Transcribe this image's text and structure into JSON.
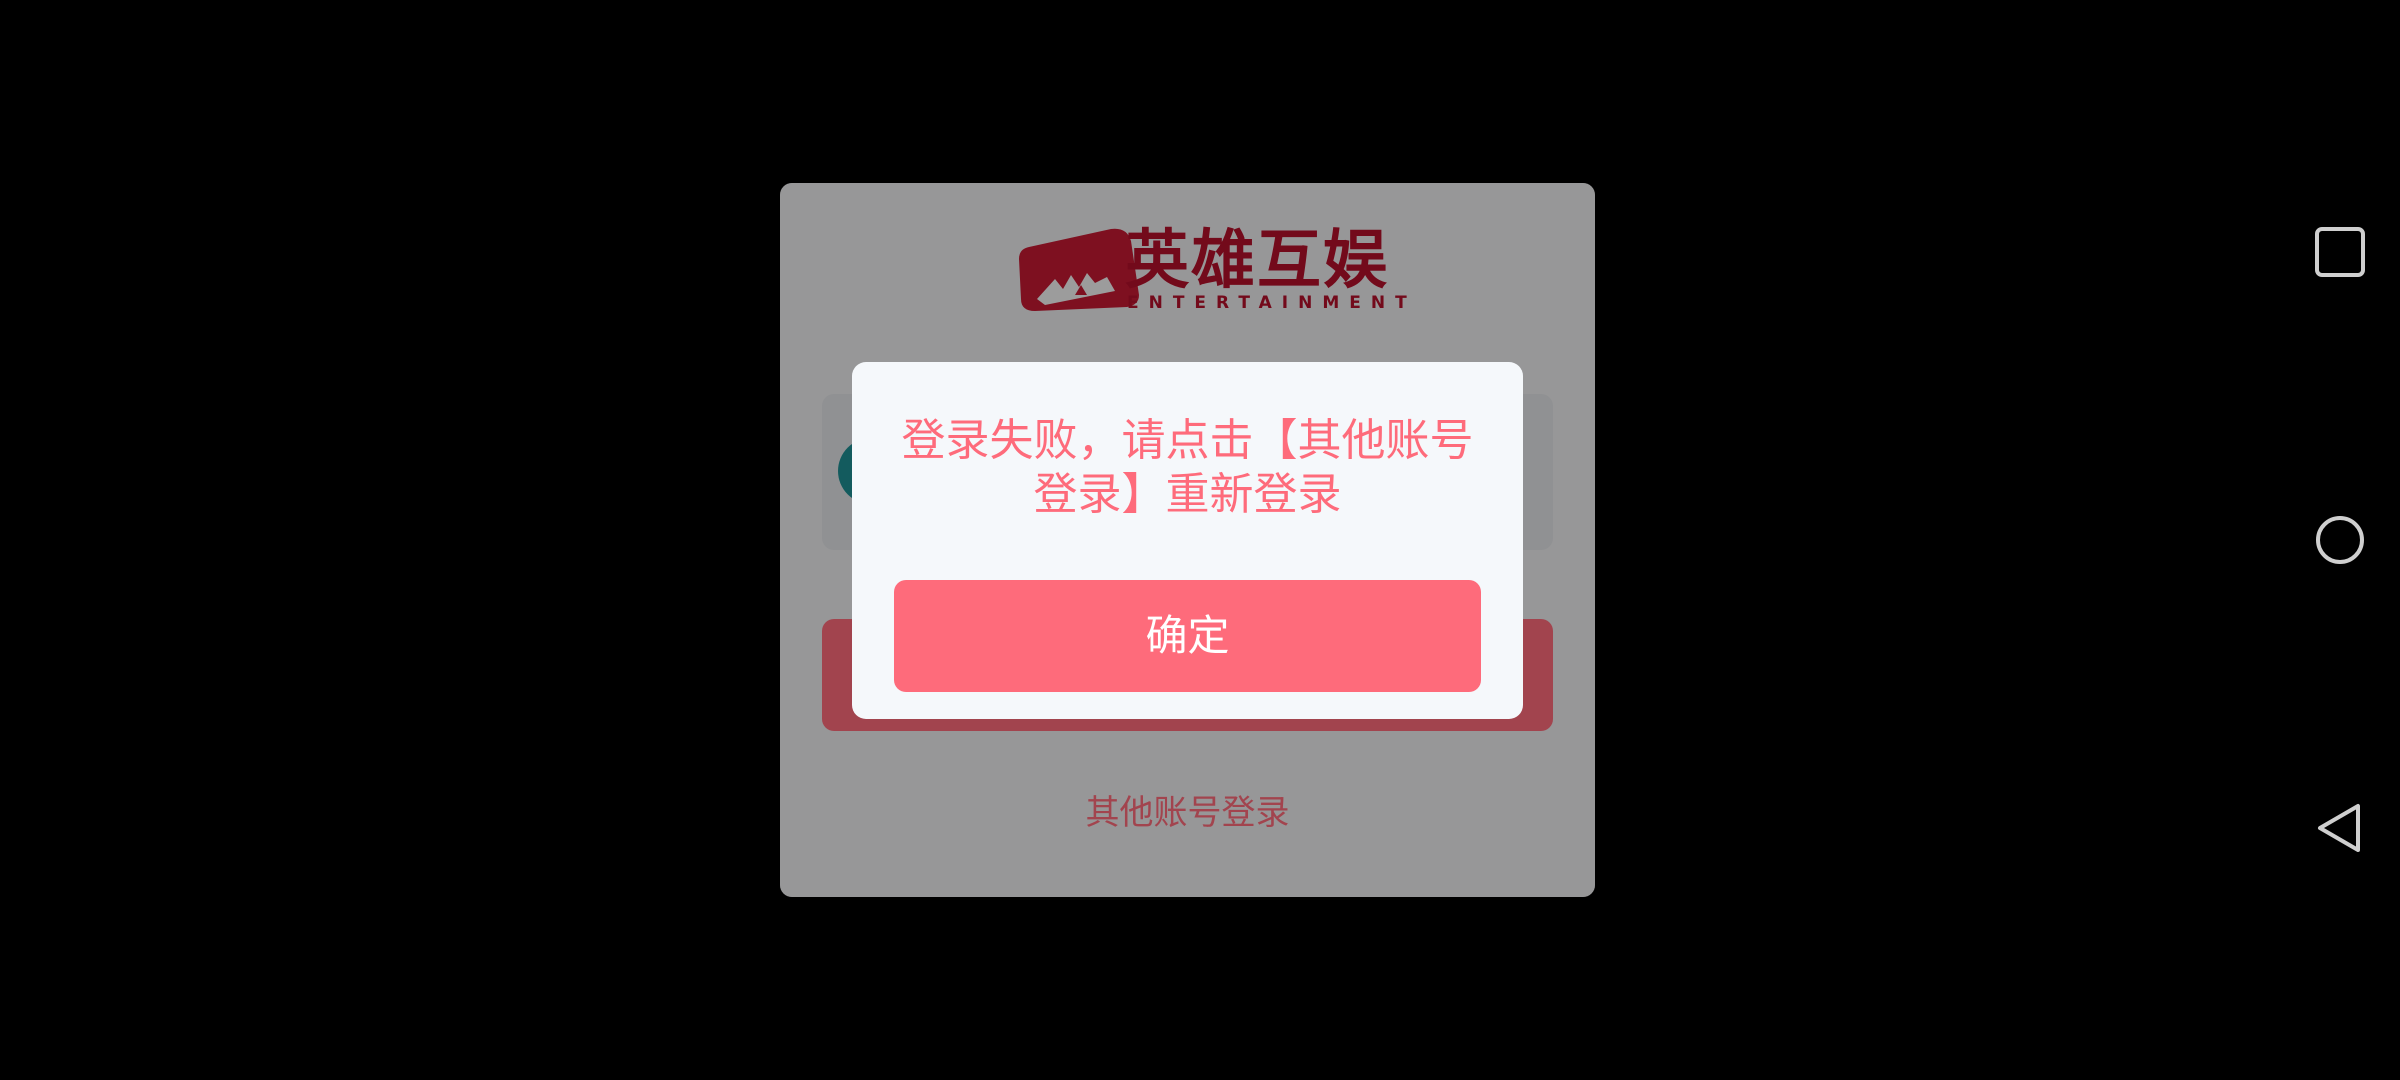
{
  "login_card": {
    "logo_text": "英雄互娱",
    "logo_subtext": "ENTERTAINMENT",
    "other_account_login": "其他账号登录"
  },
  "dialog": {
    "message": "登录失败，请点击【其他账号登录】重新登录",
    "confirm_label": "确定"
  },
  "nav_bar": {
    "icons": [
      "recents-square-icon",
      "home-circle-icon",
      "back-triangle-icon"
    ]
  },
  "colors": {
    "accent": "#fe6b7b",
    "brand": "#b5102b",
    "dialog_bg": "#f5f8fb",
    "background": "#000000"
  }
}
